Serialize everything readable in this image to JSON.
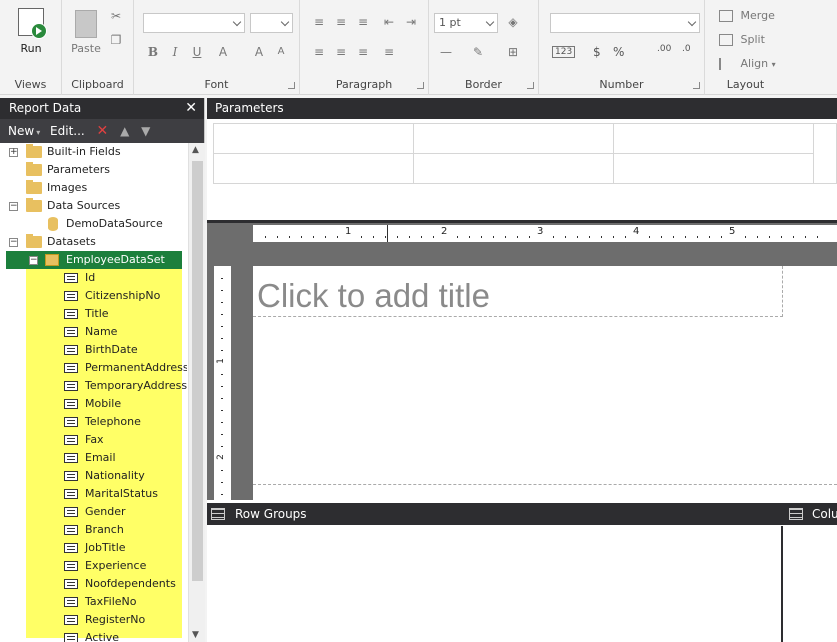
{
  "ribbon": {
    "views": {
      "run_label": "Run",
      "group_label": "Views"
    },
    "clipboard": {
      "paste_label": "Paste",
      "group_label": "Clipboard"
    },
    "font": {
      "group_label": "Font"
    },
    "paragraph": {
      "group_label": "Paragraph"
    },
    "border": {
      "width_value": "1 pt",
      "group_label": "Border"
    },
    "number": {
      "group_label": "Number",
      "currency": "$",
      "percent": "%",
      "decimals": "123"
    },
    "layout": {
      "merge_label": "Merge",
      "split_label": "Split",
      "align_label": "Align",
      "group_label": "Layout"
    }
  },
  "report_data": {
    "title": "Report Data",
    "toolbar": {
      "new_label": "New",
      "edit_label": "Edit..."
    },
    "tree": [
      {
        "label": "Built-in Fields",
        "type": "folder",
        "expander": "+"
      },
      {
        "label": "Parameters",
        "type": "folder"
      },
      {
        "label": "Images",
        "type": "folder"
      },
      {
        "label": "Data Sources",
        "type": "folder",
        "expander": "−"
      },
      {
        "label": "DemoDataSource",
        "type": "datasource"
      },
      {
        "label": "Datasets",
        "type": "folder",
        "expander": "−"
      },
      {
        "label": "EmployeeDataSet",
        "type": "dataset",
        "expander": "−"
      }
    ],
    "fields": [
      "Id",
      "CitizenshipNo",
      "Title",
      "Name",
      "BirthDate",
      "PermanentAddress",
      "TemporaryAddress",
      "Mobile",
      "Telephone",
      "Fax",
      "Email",
      "Nationality",
      "MaritalStatus",
      "Gender",
      "Branch",
      "JobTitle",
      "Experience",
      "Noofdependents",
      "TaxFileNo",
      "RegisterNo",
      "Active"
    ]
  },
  "parameters": {
    "title": "Parameters"
  },
  "design": {
    "title_placeholder": "Click to add title",
    "ruler_numbers": [
      "1",
      "2",
      "3",
      "4",
      "5"
    ],
    "vruler_numbers": [
      "1",
      "2"
    ]
  },
  "groups": {
    "row_groups_label": "Row Groups",
    "column_groups_label": "Colu"
  },
  "colors": {
    "selected": "#1c7f3c",
    "highlight": "#ffff66",
    "dark_header": "#2d2d30"
  }
}
